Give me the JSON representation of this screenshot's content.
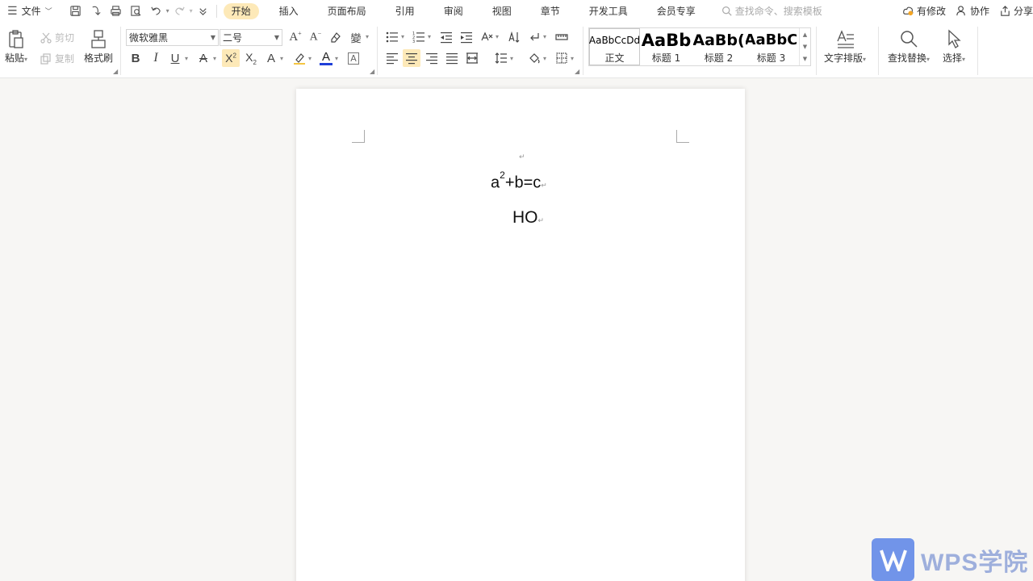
{
  "menubar": {
    "file_label": "文件",
    "tabs": [
      {
        "label": "开始",
        "active": true
      },
      {
        "label": "插入"
      },
      {
        "label": "页面布局"
      },
      {
        "label": "引用"
      },
      {
        "label": "审阅"
      },
      {
        "label": "视图"
      },
      {
        "label": "章节"
      },
      {
        "label": "开发工具"
      },
      {
        "label": "会员专享"
      }
    ],
    "search_placeholder": "查找命令、搜索模板",
    "modified_label": "有修改",
    "collab_label": "协作",
    "share_label": "分享"
  },
  "ribbon": {
    "paste_label": "粘贴",
    "cut_label": "剪切",
    "copy_label": "复制",
    "format_painter_label": "格式刷",
    "font_name": "微软雅黑",
    "font_size": "二号",
    "styles": [
      {
        "sample": "AaBbCcDd",
        "name": "正文"
      },
      {
        "sample": "AaBb",
        "name": "标题 1"
      },
      {
        "sample": "AaBb(",
        "name": "标题 2"
      },
      {
        "sample": "AaBbC",
        "name": "标题 3"
      }
    ],
    "text_layout_label": "文字排版",
    "find_replace_label": "查找替换",
    "select_label": "选择",
    "accent_color": "#fde9b8",
    "font_color": "#1f3fd8"
  },
  "document": {
    "line1_base": "a",
    "line1_sup": "2",
    "line1_rest": "+b=c",
    "line2": "HO"
  },
  "watermark": {
    "text": "WPS学院"
  }
}
